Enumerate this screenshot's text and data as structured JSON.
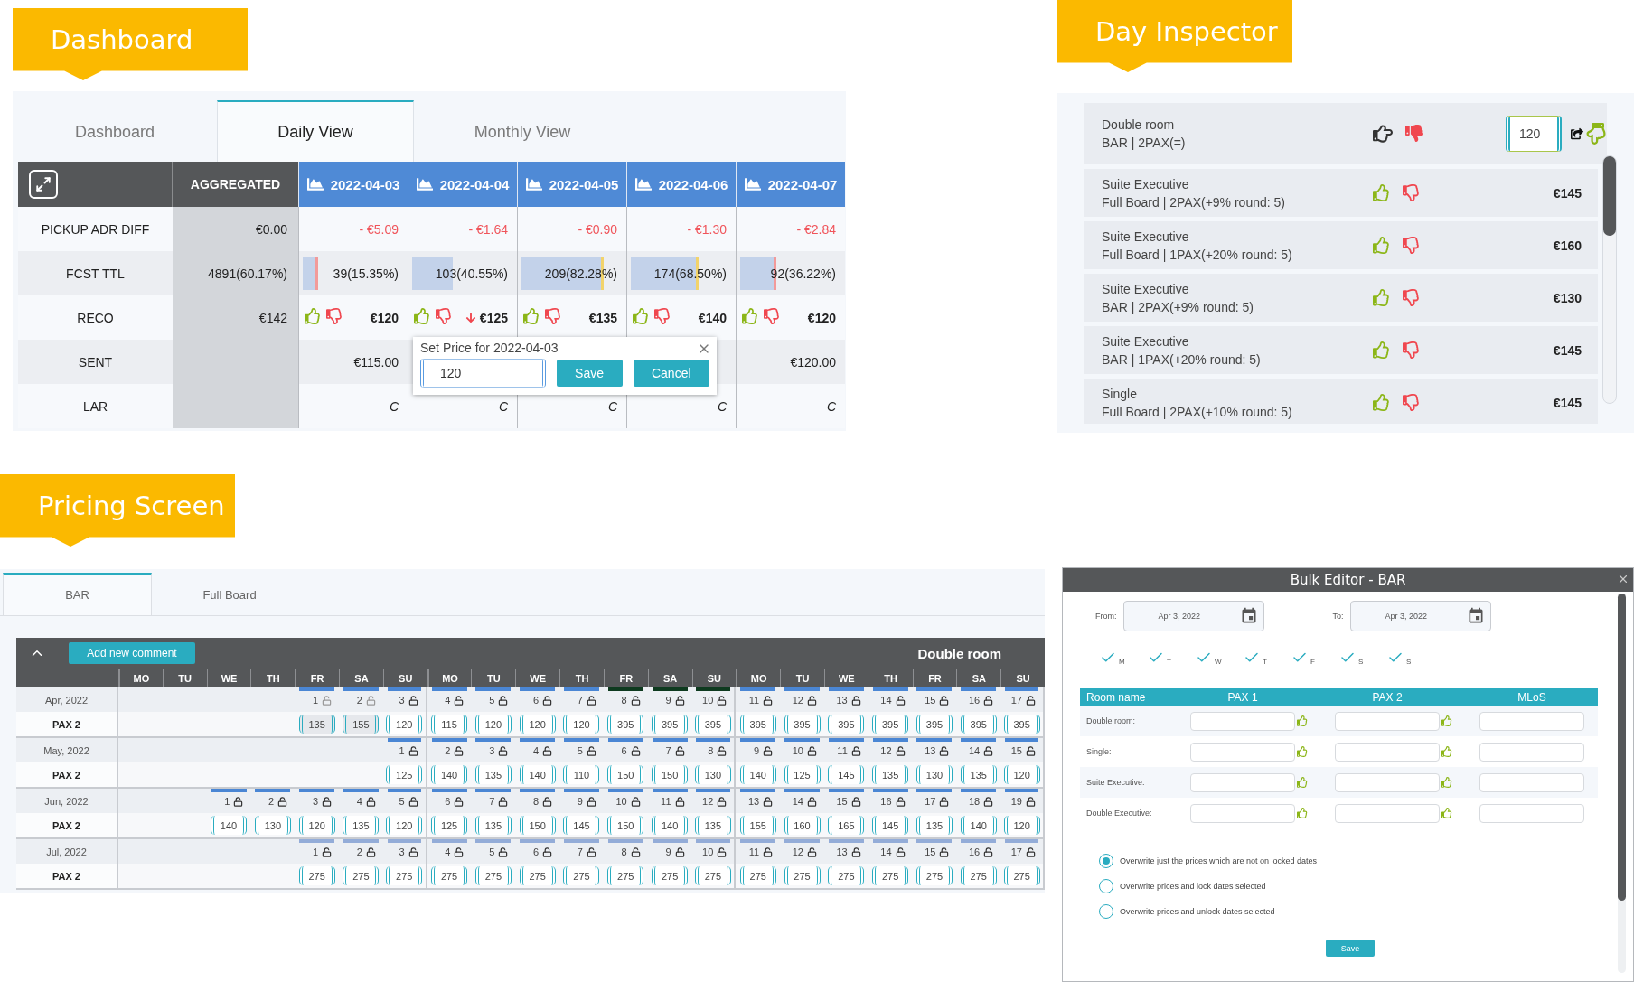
{
  "dashboard": {
    "label": "Dashboard",
    "tabs": [
      {
        "label": "Dashboard",
        "selected": false
      },
      {
        "label": "Daily View",
        "selected": true
      },
      {
        "label": "Monthly View",
        "selected": false
      }
    ],
    "table": {
      "aggregate_header": "AGGREGATED",
      "dates": [
        "2022-04-03",
        "2022-04-04",
        "2022-04-05",
        "2022-04-06",
        "2022-04-07"
      ],
      "rows": [
        {
          "kind": "delta",
          "label": "PICKUP ADR DIFF",
          "aggregate": "€0.00",
          "cells": [
            {
              "text": "- €5.09"
            },
            {
              "text": "- €1.64"
            },
            {
              "text": "- €0.90"
            },
            {
              "text": "- €1.30"
            },
            {
              "text": "- €2.84"
            }
          ]
        },
        {
          "kind": "forecast",
          "label": "FCST TTL",
          "aggregate": "4891(60.17%)",
          "cells": [
            {
              "text": "39(15.35%)",
              "level": 0.1535,
              "color": "#f29a9a"
            },
            {
              "text": "103(40.55%)",
              "level": 0.4055,
              "color": "#c3d2ea"
            },
            {
              "text": "209(82.28%)",
              "level": 0.8228,
              "color": "#f2d36b"
            },
            {
              "text": "174(68.50%)",
              "level": 0.685,
              "color": "#f2d36b"
            },
            {
              "text": "92(36.22%)",
              "level": 0.3622,
              "color": "#f29a9a"
            }
          ]
        },
        {
          "kind": "reco",
          "label": "RECO",
          "aggregate": "€142",
          "cells": [
            {
              "price": "€120",
              "falling": false
            },
            {
              "price": "€125",
              "falling": true
            },
            {
              "price": "€135",
              "falling": false
            },
            {
              "price": "€140",
              "falling": false
            },
            {
              "price": "€120",
              "falling": false
            }
          ]
        },
        {
          "kind": "money",
          "label": "SENT",
          "cells": [
            {
              "text": "€115.00"
            },
            null,
            null,
            null,
            {
              "text": "€120.00"
            }
          ]
        },
        {
          "kind": "code",
          "label": "LAR",
          "cells": [
            {
              "text": "C"
            },
            {
              "text": "C"
            },
            {
              "text": "C"
            },
            {
              "text": "C"
            },
            {
              "text": "C"
            }
          ]
        }
      ]
    },
    "popup": {
      "title": "Set Price for 2022-04-03",
      "value": "120",
      "buttons": [
        "Save",
        "Cancel"
      ]
    }
  },
  "day_inspector": {
    "label": "Day Inspector",
    "current": {
      "name": "Double room",
      "detail": "BAR | 2PAX(=)",
      "value": "120",
      "disliked": true
    },
    "rooms": [
      {
        "name": "Suite Executive",
        "detail": "Full Board | 2PAX(+9% round: 5)",
        "price": "€145",
        "disliked": false
      },
      {
        "name": "Suite Executive",
        "detail": "Full Board | 1PAX(+20% round: 5)",
        "price": "€160",
        "disliked": false
      },
      {
        "name": "Suite Executive",
        "detail": "BAR | 2PAX(+9% round: 5)",
        "price": "€130",
        "disliked": false
      },
      {
        "name": "Suite Executive",
        "detail": "BAR | 1PAX(+20% round: 5)",
        "price": "€145",
        "disliked": false
      },
      {
        "name": "Single",
        "detail": "Full Board | 2PAX(+10% round: 5)",
        "price": "€145",
        "disliked": false
      }
    ]
  },
  "pricing": {
    "label": "Pricing Screen",
    "tabs": [
      {
        "label": "BAR",
        "selected": true
      },
      {
        "label": "Full Board",
        "selected": false
      }
    ],
    "add_comment": "Add new comment",
    "room": "Double room",
    "weekdays": [
      "MO",
      "TU",
      "WE",
      "TH",
      "FR",
      "SA",
      "SU",
      "MO",
      "TU",
      "WE",
      "TH",
      "FR",
      "SA",
      "SU",
      "MO",
      "TU",
      "WE",
      "TH",
      "FR",
      "SA",
      "SU"
    ],
    "months": [
      {
        "month": "Apr, 2022",
        "row_label": "PAX 2",
        "cells": [
          null,
          null,
          null,
          null,
          {
            "day": "1",
            "price": "135",
            "disabled": true,
            "color": "#4a86d4"
          },
          {
            "day": "2",
            "price": "155",
            "disabled": true,
            "color": "#4a86d4"
          },
          {
            "day": "3",
            "price": "120",
            "disabled": false,
            "color": "#4a86d4"
          },
          {
            "day": "4",
            "price": "115",
            "disabled": false,
            "color": "#4a86d4"
          },
          {
            "day": "5",
            "price": "120",
            "disabled": false,
            "color": "#4a86d4"
          },
          {
            "day": "6",
            "price": "120",
            "disabled": false,
            "color": "#4a86d4"
          },
          {
            "day": "7",
            "price": "120",
            "disabled": false,
            "color": "#4a86d4"
          },
          {
            "day": "8",
            "price": "395",
            "disabled": false,
            "color": "#0e3a1f"
          },
          {
            "day": "9",
            "price": "395",
            "disabled": false,
            "color": "#0e3a1f"
          },
          {
            "day": "10",
            "price": "395",
            "disabled": false,
            "color": "#0e3a1f"
          },
          {
            "day": "11",
            "price": "395",
            "disabled": false,
            "color": "#4a86d4"
          },
          {
            "day": "12",
            "price": "395",
            "disabled": false,
            "color": "#4a86d4"
          },
          {
            "day": "13",
            "price": "395",
            "disabled": false,
            "color": "#4a86d4"
          },
          {
            "day": "14",
            "price": "395",
            "disabled": false,
            "color": "#4a86d4"
          },
          {
            "day": "15",
            "price": "395",
            "disabled": false,
            "color": "#4a86d4"
          },
          {
            "day": "16",
            "price": "395",
            "disabled": false,
            "color": "#4a86d4"
          },
          {
            "day": "17",
            "price": "395",
            "disabled": false,
            "color": "#4a86d4"
          }
        ]
      },
      {
        "month": "May, 2022",
        "row_label": "PAX 2",
        "cells": [
          null,
          null,
          null,
          null,
          null,
          null,
          {
            "day": "1",
            "price": "125",
            "disabled": false,
            "color": "#4a86d4"
          },
          {
            "day": "2",
            "price": "140",
            "disabled": false,
            "color": "#4a86d4"
          },
          {
            "day": "3",
            "price": "135",
            "disabled": false,
            "color": "#4a86d4"
          },
          {
            "day": "4",
            "price": "140",
            "disabled": false,
            "color": "#4a86d4"
          },
          {
            "day": "5",
            "price": "110",
            "disabled": false,
            "color": "#4a86d4"
          },
          {
            "day": "6",
            "price": "150",
            "disabled": false,
            "color": "#4a86d4"
          },
          {
            "day": "7",
            "price": "150",
            "disabled": false,
            "color": "#4a86d4"
          },
          {
            "day": "8",
            "price": "130",
            "disabled": false,
            "color": "#4a86d4"
          },
          {
            "day": "9",
            "price": "140",
            "disabled": false,
            "color": "#4a86d4"
          },
          {
            "day": "10",
            "price": "125",
            "disabled": false,
            "color": "#4a86d4"
          },
          {
            "day": "11",
            "price": "145",
            "disabled": false,
            "color": "#4a86d4"
          },
          {
            "day": "12",
            "price": "135",
            "disabled": false,
            "color": "#4a86d4"
          },
          {
            "day": "13",
            "price": "130",
            "disabled": false,
            "color": "#4a86d4"
          },
          {
            "day": "14",
            "price": "135",
            "disabled": false,
            "color": "#4a86d4"
          },
          {
            "day": "15",
            "price": "120",
            "disabled": false,
            "color": "#4a86d4"
          }
        ]
      },
      {
        "month": "Jun, 2022",
        "row_label": "PAX 2",
        "cells": [
          null,
          null,
          {
            "day": "1",
            "price": "140",
            "disabled": false,
            "color": "#4a86d4"
          },
          {
            "day": "2",
            "price": "130",
            "disabled": false,
            "color": "#4a86d4"
          },
          {
            "day": "3",
            "price": "120",
            "disabled": false,
            "color": "#4a86d4"
          },
          {
            "day": "4",
            "price": "135",
            "disabled": false,
            "color": "#4a86d4"
          },
          {
            "day": "5",
            "price": "120",
            "disabled": false,
            "color": "#4a86d4"
          },
          {
            "day": "6",
            "price": "125",
            "disabled": false,
            "color": "#4a86d4"
          },
          {
            "day": "7",
            "price": "135",
            "disabled": false,
            "color": "#4a86d4"
          },
          {
            "day": "8",
            "price": "150",
            "disabled": false,
            "color": "#4a86d4"
          },
          {
            "day": "9",
            "price": "145",
            "disabled": false,
            "color": "#4a86d4"
          },
          {
            "day": "10",
            "price": "150",
            "disabled": false,
            "color": "#4a86d4"
          },
          {
            "day": "11",
            "price": "140",
            "disabled": false,
            "color": "#4a86d4"
          },
          {
            "day": "12",
            "price": "135",
            "disabled": false,
            "color": "#4a86d4"
          },
          {
            "day": "13",
            "price": "155",
            "disabled": false,
            "color": "#4a86d4"
          },
          {
            "day": "14",
            "price": "160",
            "disabled": false,
            "color": "#4a86d4"
          },
          {
            "day": "15",
            "price": "165",
            "disabled": false,
            "color": "#4a86d4"
          },
          {
            "day": "16",
            "price": "145",
            "disabled": false,
            "color": "#4a86d4"
          },
          {
            "day": "17",
            "price": "135",
            "disabled": false,
            "color": "#4a86d4"
          },
          {
            "day": "18",
            "price": "140",
            "disabled": false,
            "color": "#4a86d4"
          },
          {
            "day": "19",
            "price": "120",
            "disabled": false,
            "color": "#4a86d4"
          }
        ]
      },
      {
        "month": "Jul, 2022",
        "row_label": "PAX 2",
        "cells": [
          null,
          null,
          null,
          null,
          {
            "day": "1",
            "price": "275",
            "disabled": false,
            "color": "#93acd8"
          },
          {
            "day": "2",
            "price": "275",
            "disabled": false,
            "color": "#93acd8"
          },
          {
            "day": "3",
            "price": "275",
            "disabled": false,
            "color": "#93acd8"
          },
          {
            "day": "4",
            "price": "275",
            "disabled": false,
            "color": "#93acd8"
          },
          {
            "day": "5",
            "price": "275",
            "disabled": false,
            "color": "#93acd8"
          },
          {
            "day": "6",
            "price": "275",
            "disabled": false,
            "color": "#93acd8"
          },
          {
            "day": "7",
            "price": "275",
            "disabled": false,
            "color": "#93acd8"
          },
          {
            "day": "8",
            "price": "275",
            "disabled": false,
            "color": "#93acd8"
          },
          {
            "day": "9",
            "price": "275",
            "disabled": false,
            "color": "#93acd8"
          },
          {
            "day": "10",
            "price": "275",
            "disabled": false,
            "color": "#93acd8"
          },
          {
            "day": "11",
            "price": "275",
            "disabled": false,
            "color": "#93acd8"
          },
          {
            "day": "12",
            "price": "275",
            "disabled": false,
            "color": "#93acd8"
          },
          {
            "day": "13",
            "price": "275",
            "disabled": false,
            "color": "#93acd8"
          },
          {
            "day": "14",
            "price": "275",
            "disabled": false,
            "color": "#93acd8"
          },
          {
            "day": "15",
            "price": "275",
            "disabled": false,
            "color": "#93acd8"
          },
          {
            "day": "16",
            "price": "275",
            "disabled": false,
            "color": "#93acd8"
          },
          {
            "day": "17",
            "price": "275",
            "disabled": false,
            "color": "#93acd8"
          }
        ]
      }
    ]
  },
  "bulk_editor": {
    "title": "Bulk Editor - BAR",
    "from": {
      "label": "From:",
      "value": "Apr 3, 2022"
    },
    "to": {
      "label": "To:",
      "value": "Apr 3, 2022"
    },
    "weekdays": [
      {
        "label": "M",
        "checked": true
      },
      {
        "label": "T",
        "checked": true
      },
      {
        "label": "W",
        "checked": true
      },
      {
        "label": "T",
        "checked": true
      },
      {
        "label": "F",
        "checked": true
      },
      {
        "label": "S",
        "checked": true
      },
      {
        "label": "S",
        "checked": true
      }
    ],
    "columns": [
      "Room name",
      "PAX 1",
      "PAX 2",
      "MLoS"
    ],
    "rooms": [
      "Double room:",
      "Single:",
      "Suite Executive:",
      "Double Executive:"
    ],
    "options": [
      {
        "label": "Overwrite just the prices which are not on locked dates",
        "selected": true
      },
      {
        "label": "Overwrite prices and lock dates selected",
        "selected": false
      },
      {
        "label": "Overwrite prices and unlock dates selected",
        "selected": false
      }
    ],
    "save": "Save"
  }
}
